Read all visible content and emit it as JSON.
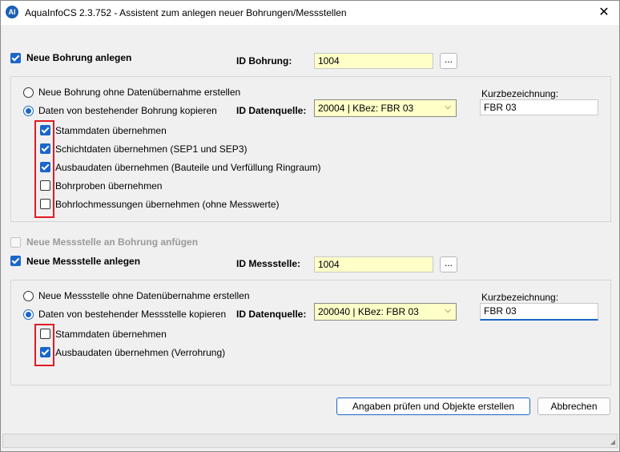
{
  "window": {
    "title": "AquaInfoCS 2.3.752 - Assistent zum anlegen neuer Bohrungen/Messstellen",
    "icon_text": "AI",
    "close": "✕"
  },
  "bohrung": {
    "create_label": "Neue Bohrung anlegen",
    "create_checked": true,
    "id_label": "ID Bohrung:",
    "id_value": "1004",
    "browse": "...",
    "radio_new": "Neue Bohrung ohne Datenübernahme erstellen",
    "radio_copy": "Daten von bestehender Bohrung kopieren",
    "selected_radio": "copy",
    "source_label": "ID Datenquelle:",
    "source_value": "20004  |  KBez: FBR 03",
    "short_label": "Kurzbezeichnung:",
    "short_value": "FBR 03",
    "options": [
      {
        "label": "Stammdaten übernehmen",
        "checked": true
      },
      {
        "label": "Schichtdaten übernehmen (SEP1 und SEP3)",
        "checked": true
      },
      {
        "label": "Ausbaudaten übernehmen (Bauteile und Verfüllung Ringraum)",
        "checked": true
      },
      {
        "label": "Bohrproben übernehmen",
        "checked": false
      },
      {
        "label": "Bohrlochmessungen übernehmen (ohne Messwerte)",
        "checked": false
      }
    ]
  },
  "attach_label": "Neue Messstelle an Bohrung anfügen",
  "messstelle": {
    "create_label": "Neue Messstelle anlegen",
    "create_checked": true,
    "id_label": "ID Messstelle:",
    "id_value": "1004",
    "browse": "...",
    "radio_new": "Neue Messstelle ohne Datenübernahme erstellen",
    "radio_copy": "Daten von bestehender Messstelle kopieren",
    "selected_radio": "copy",
    "source_label": "ID Datenquelle:",
    "source_value": "200040  |  KBez: FBR 03",
    "short_label": "Kurzbezeichnung:",
    "short_value": "FBR 03",
    "options": [
      {
        "label": "Stammdaten übernehmen",
        "checked": false
      },
      {
        "label": "Ausbaudaten übernehmen (Verrohrung)",
        "checked": true
      }
    ]
  },
  "buttons": {
    "submit": "Angaben prüfen und Objekte erstellen",
    "cancel": "Abbrechen"
  },
  "colors": {
    "accent": "#1a66c9",
    "field_yellow": "#ffffc8",
    "highlight_red": "#e01b24"
  }
}
